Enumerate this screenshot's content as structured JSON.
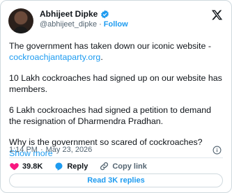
{
  "author": {
    "name": "Abhijeet Dipke",
    "handle": "@abhijeet_dipke",
    "separator": "·",
    "follow_label": "Follow"
  },
  "tweet": {
    "para1_text": "The government has taken down our iconic website - ",
    "para1_link": "cockroachjantaparty.org",
    "para1_end": ".",
    "para2": "10 Lakh cockroaches had signed up on our website has members.",
    "para3": "6 Lakh cockroaches had signed a petition to demand the resignation of Dharmendra Pradhan.",
    "para4": "Why is the government so scared of cockroaches? ",
    "show_more": "Show more"
  },
  "timestamp": {
    "time": "1:14 PM",
    "separator": "·",
    "date": "May 23, 2026"
  },
  "actions": {
    "likes": "39.8K",
    "reply_label": "Reply",
    "copy_label": "Copy link"
  },
  "read_replies_label": "Read 3K replies",
  "colors": {
    "accent": "#1d9bf0",
    "like": "#f91880",
    "text": "#0f1419",
    "muted": "#536471"
  },
  "icons": [
    "verified-badge-icon",
    "x-logo-icon",
    "info-icon",
    "heart-icon",
    "reply-icon",
    "link-icon"
  ]
}
